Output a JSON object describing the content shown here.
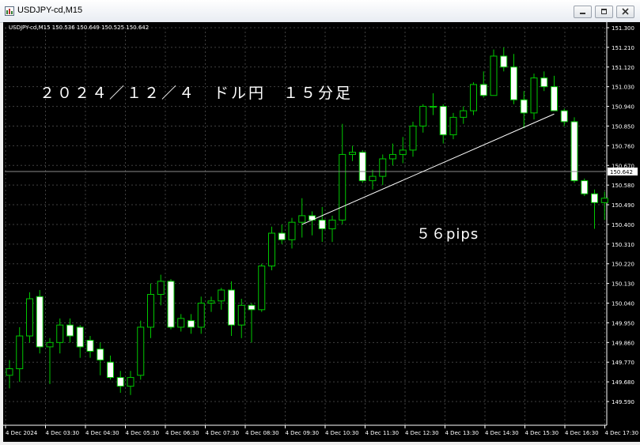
{
  "window": {
    "title": "USDJPY-cd,M15"
  },
  "chart_header": "USDJPY-cd,M15  150.536 150.649 150.525 150.642",
  "current_price_label": "150.642",
  "annotations": {
    "title": "２０２４／１２／４　ドル円　１５分足",
    "pips": "５６pips"
  },
  "colors": {
    "background": "#000000",
    "bull": "#00c800",
    "bear": "#ffffff",
    "grid": "#404040",
    "axis_text": "#ffffff",
    "price_line": "#8a8a8a"
  },
  "icons": {
    "app": "chart-app-icon",
    "minimize": "minimize-icon",
    "restore": "restore-icon",
    "close": "close-icon"
  },
  "chart_data": {
    "type": "candlestick",
    "title": "",
    "xlabel": "",
    "ylabel": "",
    "grid": true,
    "ylim": [
      149.59,
      151.3
    ],
    "y_ticks": [
      "151.300",
      "151.210",
      "151.120",
      "151.030",
      "150.940",
      "150.850",
      "150.760",
      "150.670",
      "150.580",
      "150.490",
      "150.400",
      "150.310",
      "150.220",
      "150.130",
      "150.040",
      "149.950",
      "149.860",
      "149.770",
      "149.680",
      "149.590"
    ],
    "x_ticks": [
      "4 Dec 2024",
      "4 Dec 03:30",
      "4 Dec 04:30",
      "4 Dec 05:30",
      "4 Dec 06:30",
      "4 Dec 07:30",
      "4 Dec 08:30",
      "4 Dec 09:30",
      "4 Dec 10:30",
      "4 Dec 11:30",
      "4 Dec 12:30",
      "4 Dec 13:30",
      "4 Dec 14:30",
      "4 Dec 15:30",
      "4 Dec 16:30",
      "4 Dec 17:30"
    ],
    "candles": [
      {
        "o": 149.71,
        "h": 149.78,
        "l": 149.65,
        "c": 149.74
      },
      {
        "o": 149.74,
        "h": 149.93,
        "l": 149.68,
        "c": 149.89
      },
      {
        "o": 149.89,
        "h": 150.09,
        "l": 149.86,
        "c": 150.06
      },
      {
        "o": 150.07,
        "h": 150.1,
        "l": 149.81,
        "c": 149.84
      },
      {
        "o": 149.84,
        "h": 149.88,
        "l": 149.67,
        "c": 149.86
      },
      {
        "o": 149.86,
        "h": 149.97,
        "l": 149.81,
        "c": 149.94
      },
      {
        "o": 149.94,
        "h": 149.97,
        "l": 149.86,
        "c": 149.89
      },
      {
        "o": 149.93,
        "h": 149.94,
        "l": 149.79,
        "c": 149.84
      },
      {
        "o": 149.87,
        "h": 149.89,
        "l": 149.79,
        "c": 149.82
      },
      {
        "o": 149.83,
        "h": 149.86,
        "l": 149.71,
        "c": 149.78
      },
      {
        "o": 149.77,
        "h": 149.8,
        "l": 149.69,
        "c": 149.7
      },
      {
        "o": 149.7,
        "h": 149.73,
        "l": 149.63,
        "c": 149.66
      },
      {
        "o": 149.66,
        "h": 149.73,
        "l": 149.62,
        "c": 149.7
      },
      {
        "o": 149.71,
        "h": 149.96,
        "l": 149.69,
        "c": 149.93
      },
      {
        "o": 149.93,
        "h": 150.13,
        "l": 149.88,
        "c": 150.08
      },
      {
        "o": 150.08,
        "h": 150.17,
        "l": 150.03,
        "c": 150.14
      },
      {
        "o": 150.14,
        "h": 150.15,
        "l": 149.92,
        "c": 149.93
      },
      {
        "o": 149.93,
        "h": 149.99,
        "l": 149.91,
        "c": 149.97
      },
      {
        "o": 149.96,
        "h": 149.99,
        "l": 149.9,
        "c": 149.93
      },
      {
        "o": 149.93,
        "h": 150.07,
        "l": 149.9,
        "c": 150.04
      },
      {
        "o": 150.04,
        "h": 150.07,
        "l": 150.0,
        "c": 150.05
      },
      {
        "o": 150.05,
        "h": 150.11,
        "l": 150.01,
        "c": 150.1
      },
      {
        "o": 150.1,
        "h": 150.14,
        "l": 149.89,
        "c": 149.94
      },
      {
        "o": 149.94,
        "h": 150.06,
        "l": 149.88,
        "c": 150.03
      },
      {
        "o": 150.03,
        "h": 150.04,
        "l": 149.86,
        "c": 150.01
      },
      {
        "o": 150.01,
        "h": 150.22,
        "l": 150.0,
        "c": 150.21
      },
      {
        "o": 150.21,
        "h": 150.39,
        "l": 150.19,
        "c": 150.36
      },
      {
        "o": 150.36,
        "h": 150.4,
        "l": 150.31,
        "c": 150.33
      },
      {
        "o": 150.33,
        "h": 150.43,
        "l": 150.29,
        "c": 150.41
      },
      {
        "o": 150.41,
        "h": 150.52,
        "l": 150.34,
        "c": 150.44
      },
      {
        "o": 150.44,
        "h": 150.46,
        "l": 150.35,
        "c": 150.42
      },
      {
        "o": 150.42,
        "h": 150.48,
        "l": 150.32,
        "c": 150.38
      },
      {
        "o": 150.38,
        "h": 150.44,
        "l": 150.32,
        "c": 150.42
      },
      {
        "o": 150.42,
        "h": 150.86,
        "l": 150.4,
        "c": 150.72
      },
      {
        "o": 150.72,
        "h": 150.76,
        "l": 150.69,
        "c": 150.73
      },
      {
        "o": 150.73,
        "h": 150.74,
        "l": 150.59,
        "c": 150.6
      },
      {
        "o": 150.6,
        "h": 150.65,
        "l": 150.56,
        "c": 150.62
      },
      {
        "o": 150.62,
        "h": 150.72,
        "l": 150.58,
        "c": 150.7
      },
      {
        "o": 150.7,
        "h": 150.77,
        "l": 150.67,
        "c": 150.72
      },
      {
        "o": 150.72,
        "h": 150.8,
        "l": 150.68,
        "c": 150.74
      },
      {
        "o": 150.74,
        "h": 150.87,
        "l": 150.71,
        "c": 150.85
      },
      {
        "o": 150.85,
        "h": 150.95,
        "l": 150.82,
        "c": 150.94
      },
      {
        "o": 150.94,
        "h": 151.0,
        "l": 150.9,
        "c": 150.94
      },
      {
        "o": 150.94,
        "h": 150.95,
        "l": 150.77,
        "c": 150.81
      },
      {
        "o": 150.81,
        "h": 150.91,
        "l": 150.79,
        "c": 150.89
      },
      {
        "o": 150.89,
        "h": 150.94,
        "l": 150.86,
        "c": 150.92
      },
      {
        "o": 150.92,
        "h": 151.05,
        "l": 150.9,
        "c": 151.04
      },
      {
        "o": 151.04,
        "h": 151.1,
        "l": 150.98,
        "c": 150.99
      },
      {
        "o": 150.99,
        "h": 151.2,
        "l": 150.99,
        "c": 151.17
      },
      {
        "o": 151.17,
        "h": 151.21,
        "l": 151.1,
        "c": 151.12
      },
      {
        "o": 151.12,
        "h": 151.18,
        "l": 150.95,
        "c": 150.97
      },
      {
        "o": 150.97,
        "h": 151.01,
        "l": 150.84,
        "c": 150.91
      },
      {
        "o": 150.91,
        "h": 151.09,
        "l": 150.88,
        "c": 151.07
      },
      {
        "o": 151.07,
        "h": 151.1,
        "l": 151.01,
        "c": 151.03
      },
      {
        "o": 151.03,
        "h": 151.08,
        "l": 150.92,
        "c": 150.92
      },
      {
        "o": 150.92,
        "h": 150.93,
        "l": 150.85,
        "c": 150.87
      },
      {
        "o": 150.87,
        "h": 150.89,
        "l": 150.59,
        "c": 150.6
      },
      {
        "o": 150.6,
        "h": 150.61,
        "l": 150.53,
        "c": 150.54
      },
      {
        "o": 150.54,
        "h": 150.56,
        "l": 150.38,
        "c": 150.5
      },
      {
        "o": 150.5,
        "h": 150.55,
        "l": 150.42,
        "c": 150.52
      }
    ],
    "trendline": {
      "from": {
        "candle": 29,
        "price": 150.4
      },
      "to": {
        "candle": 54,
        "price": 150.905
      }
    }
  }
}
